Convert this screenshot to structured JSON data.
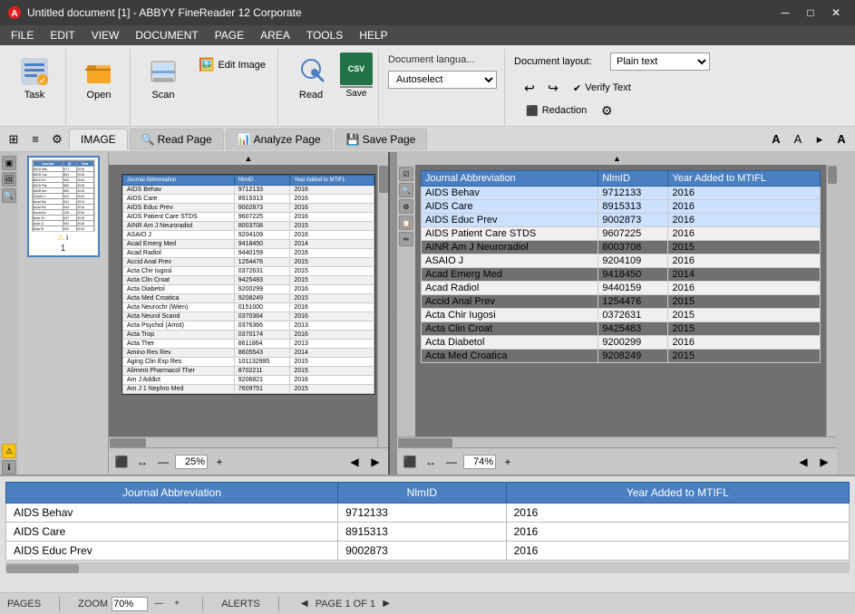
{
  "titlebar": {
    "title": "Untitled document [1] - ABBYY FineReader 12 Corporate",
    "minimize": "─",
    "maximize": "□",
    "close": "✕"
  },
  "menubar": {
    "items": [
      "FILE",
      "EDIT",
      "VIEW",
      "DOCUMENT",
      "PAGE",
      "AREA",
      "TOOLS",
      "HELP"
    ]
  },
  "ribbon": {
    "task_label": "Task",
    "open_label": "Open",
    "scan_label": "Scan",
    "edit_image_label": "Edit Image",
    "read_label": "Read",
    "save_label": "Save",
    "doc_language_label": "Document langua...",
    "autoselect_label": "Autoselect",
    "doc_layout_label": "Document layout:",
    "plain_text_label": "Plain text",
    "verify_text_label": "Verify Text",
    "undo_label": "↩",
    "redo_label": "↪",
    "redaction_label": "Redaction",
    "tools_label": "⚙"
  },
  "toolbar2": {
    "image_tab": "IMAGE",
    "read_page_tab": "Read Page",
    "analyze_page_tab": "Analyze Page",
    "save_page_tab": "Save Page"
  },
  "scan_view": {
    "zoom_value": "25%",
    "zoom_percent": "25"
  },
  "text_view": {
    "zoom_value": "74%",
    "zoom_percent": "74"
  },
  "ocr_table": {
    "headers": [
      "Journal Abbreviation",
      "NlmID",
      "Year Added to MTIFL"
    ],
    "rows": [
      [
        "AIDS Behav",
        "9712133",
        "2016"
      ],
      [
        "AIDS Care",
        "8915313",
        "2016"
      ],
      [
        "AIDS Educ Prev",
        "9002873",
        "2016"
      ],
      [
        "AIDS Patient Care STDS",
        "9607225",
        "2016"
      ],
      [
        "AINR Am J Neuroradiol",
        "8003708",
        "2015"
      ],
      [
        "ASAIO J",
        "9204109",
        "2016"
      ],
      [
        "Acad Emerg Med",
        "9418450",
        "2014"
      ],
      [
        "Acad Radiol",
        "9440159",
        "2016"
      ],
      [
        "Accid Anal Prev",
        "1254476",
        "2015"
      ],
      [
        "Acta Chir Iugosi",
        "0372631",
        "2015"
      ],
      [
        "Acta Clin Croat",
        "9425483",
        "2015"
      ],
      [
        "Acta Diabetol",
        "9200299",
        "2016"
      ],
      [
        "Acta Med Croatica",
        "9208249",
        "2015"
      ]
    ]
  },
  "bottom_table": {
    "headers": [
      "Journal Abbreviation",
      "NlmID",
      "Year Added to MTIFL"
    ],
    "rows": [
      [
        "AIDS Behav",
        "9712133",
        "2016"
      ],
      [
        "AIDS Care",
        "8915313",
        "2016"
      ],
      [
        "AIDS Educ Prev",
        "9002873",
        "2016"
      ]
    ]
  },
  "statusbar": {
    "pages_label": "PAGES",
    "zoom_label": "ZOOM",
    "alerts_label": "ALERTS",
    "page_info": "PAGE 1 OF 1",
    "zoom_value": "70%"
  },
  "thumbnail": {
    "page_number": "1"
  }
}
